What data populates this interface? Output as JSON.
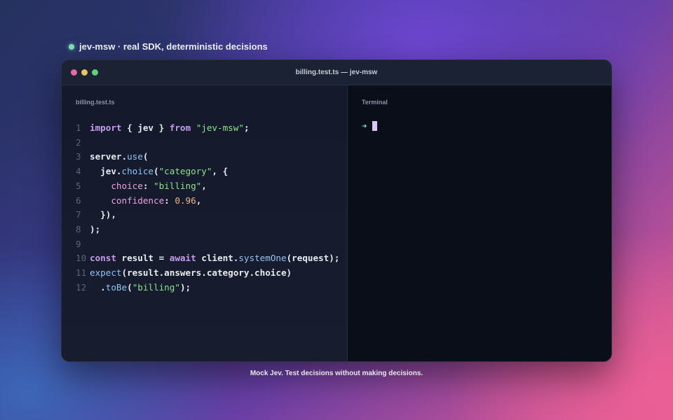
{
  "header": {
    "title": "jev-msw · real SDK, deterministic decisions"
  },
  "window": {
    "title": "billing.test.ts — jev-msw"
  },
  "editor": {
    "filename": "billing.test.ts",
    "lines": [
      {
        "n": "1",
        "tokens": [
          [
            "kw",
            "import"
          ],
          [
            "plain",
            " { jev } "
          ],
          [
            "kw",
            "from"
          ],
          [
            "plain",
            " "
          ],
          [
            "str",
            "\"jev-msw\""
          ],
          [
            "plain",
            ";"
          ]
        ]
      },
      {
        "n": "2",
        "tokens": []
      },
      {
        "n": "3",
        "tokens": [
          [
            "plain",
            "server."
          ],
          [
            "fn",
            "use"
          ],
          [
            "plain",
            "("
          ]
        ]
      },
      {
        "n": "4",
        "tokens": [
          [
            "plain",
            "  jev."
          ],
          [
            "fn",
            "choice"
          ],
          [
            "plain",
            "("
          ],
          [
            "str",
            "\"category\""
          ],
          [
            "plain",
            ", {"
          ]
        ]
      },
      {
        "n": "5",
        "tokens": [
          [
            "plain",
            "    "
          ],
          [
            "prop",
            "choice"
          ],
          [
            "plain",
            ": "
          ],
          [
            "str",
            "\"billing\""
          ],
          [
            "plain",
            ","
          ]
        ]
      },
      {
        "n": "6",
        "tokens": [
          [
            "plain",
            "    "
          ],
          [
            "prop",
            "confidence"
          ],
          [
            "plain",
            ": "
          ],
          [
            "num",
            "0.96"
          ],
          [
            "plain",
            ","
          ]
        ]
      },
      {
        "n": "7",
        "tokens": [
          [
            "plain",
            "  }),"
          ]
        ]
      },
      {
        "n": "8",
        "tokens": [
          [
            "plain",
            ");"
          ]
        ]
      },
      {
        "n": "9",
        "tokens": []
      },
      {
        "n": "10",
        "tokens": [
          [
            "kw",
            "const"
          ],
          [
            "plain",
            " result = "
          ],
          [
            "kw",
            "await"
          ],
          [
            "plain",
            " client."
          ],
          [
            "fn",
            "systemOne"
          ],
          [
            "plain",
            "(request);"
          ]
        ]
      },
      {
        "n": "11",
        "tokens": [
          [
            "fn",
            "expect"
          ],
          [
            "plain",
            "(result.answers.category.choice)"
          ]
        ]
      },
      {
        "n": "12",
        "tokens": [
          [
            "plain",
            "  ."
          ],
          [
            "fn",
            "toBe"
          ],
          [
            "plain",
            "("
          ],
          [
            "str",
            "\"billing\""
          ],
          [
            "plain",
            ");"
          ]
        ]
      }
    ]
  },
  "terminal": {
    "label": "Terminal",
    "prompt_symbol": "➜"
  },
  "footer": {
    "tagline": "Mock Jev. Test decisions without making decisions."
  }
}
